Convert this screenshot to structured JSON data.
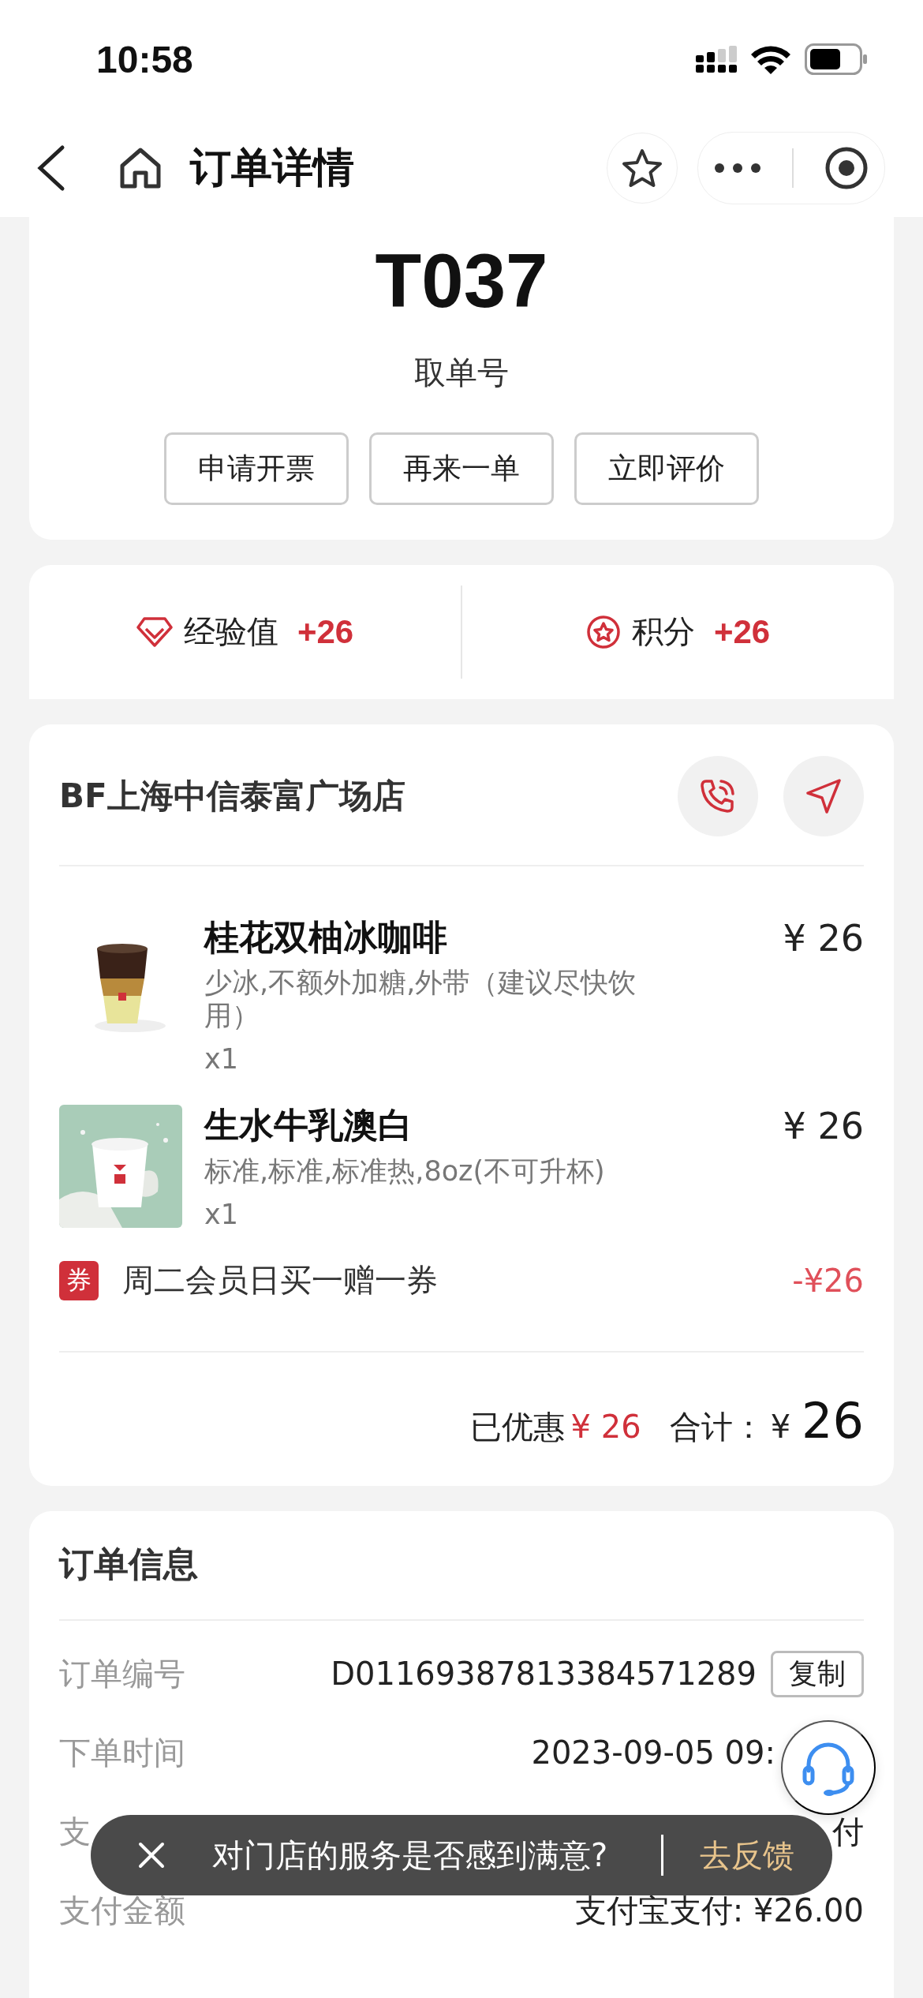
{
  "status_bar": {
    "time": "10:58"
  },
  "nav": {
    "title": "订单详情"
  },
  "pickup": {
    "number": "T037",
    "label": "取单号",
    "buttons": [
      "申请开票",
      "再来一单",
      "立即评价"
    ]
  },
  "rewards": [
    {
      "kind": "experience",
      "label": "经验值",
      "value": "+26"
    },
    {
      "kind": "points",
      "label": "积分",
      "value": "+26"
    }
  ],
  "store": {
    "name": "BF上海中信泰富广场店",
    "items": [
      {
        "name": "桂花双柚冰咖啡",
        "options": "少冰,不额外加糖,外带（建议尽快饮用）",
        "qty": "x1",
        "price": "¥ 26"
      },
      {
        "name": "生水牛乳澳白",
        "options": "标准,标准,标准热,8oz(不可升杯)",
        "qty": "x1",
        "price": "¥ 26"
      }
    ],
    "coupon": {
      "badge": "券",
      "name": "周二会员日买一赠一券",
      "amount": "-¥26"
    },
    "summary": {
      "discount_label": "已优惠",
      "discount_value": "¥ 26",
      "total_label": "合计：",
      "total_currency": "¥",
      "total_value": "26"
    }
  },
  "order_info": {
    "title": "订单信息",
    "rows": [
      {
        "label": "订单编号",
        "value": "D01169387813384571289",
        "action": "复制"
      },
      {
        "label": "下单时间",
        "value": "2023-09-05 09:"
      },
      {
        "label": "支",
        "value": "付"
      },
      {
        "label": "支付金额",
        "value": "支付宝支付: ¥26.00"
      }
    ]
  },
  "toast": {
    "message": "对门店的服务是否感到满意?",
    "action": "去反馈"
  }
}
